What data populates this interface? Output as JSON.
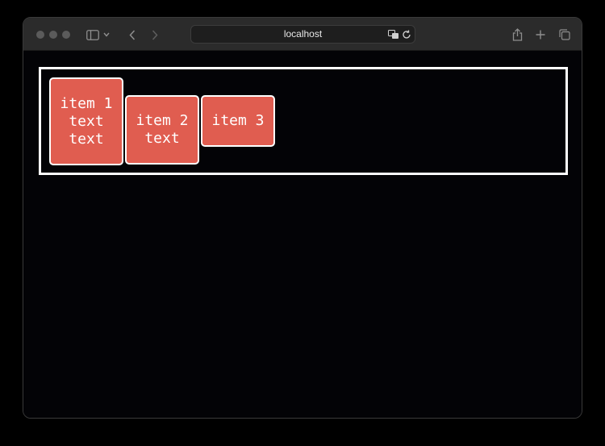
{
  "browser": {
    "address": "localhost"
  },
  "page": {
    "items": [
      {
        "label": "item 1\ntext\ntext"
      },
      {
        "label": "item 2\ntext"
      },
      {
        "label": "item 3"
      }
    ]
  },
  "colors": {
    "item_fill": "#e05d50",
    "item_border": "#ffffff",
    "container_border": "#ffffff",
    "page_background": "#030306",
    "toolbar_background": "#2b2b2b"
  }
}
